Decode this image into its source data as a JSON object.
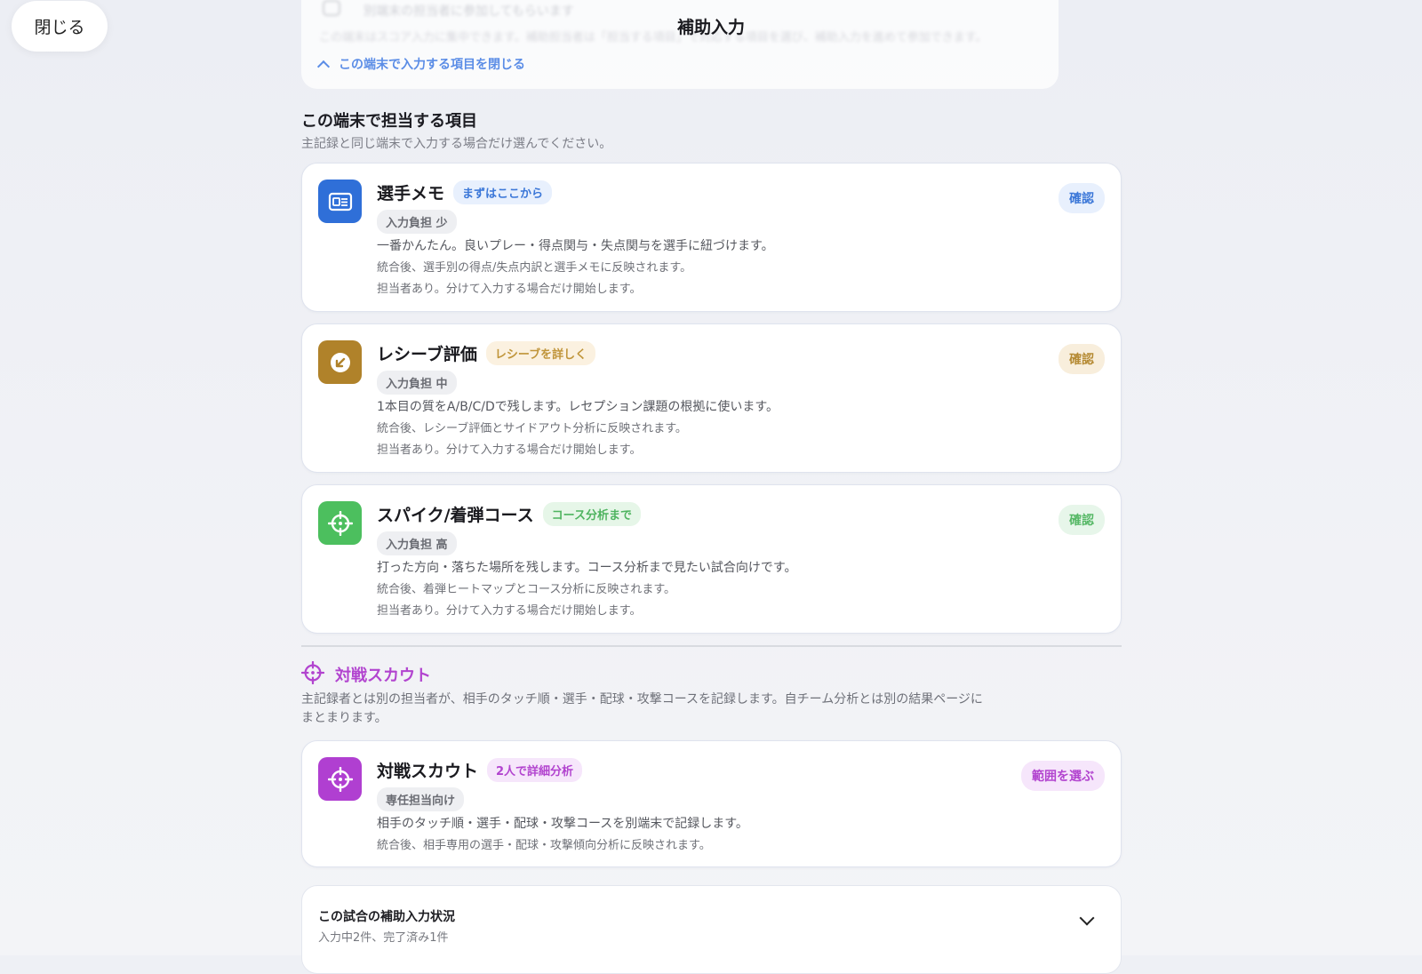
{
  "header": {
    "close_label": "閉じる",
    "title": "補助入力"
  },
  "top_panel": {
    "ghost_line1": "別端末の担当者に参加してもらいます",
    "ghost_line2": "この端末はスコア入力に集中できます。補助担当者は「担当する項目」で対応する項目を選び、補助入力を進めて参加できます。",
    "collapse_label": "この端末で入力する項目を閉じる"
  },
  "section": {
    "title": "この端末で担当する項目",
    "subtitle": "主記録と同じ端末で入力する場合だけ選んでください。"
  },
  "cards": [
    {
      "title": "選手メモ",
      "tag": "まずはここから",
      "load": "入力負担 少",
      "desc": "一番かんたん。良いプレー・得点関与・失点関与を選手に紐づけます。",
      "result": "統合後、選手別の得点/失点内訳と選手メモに反映されます。",
      "note": "担当者あり。分けて入力する場合だけ開始します。",
      "action": "確認",
      "icon": "id-card-icon",
      "accent": "#2f6fd8"
    },
    {
      "title": "レシーブ評価",
      "tag": "レシーブを詳しく",
      "load": "入力負担 中",
      "desc": "1本目の質をA/B/C/Dで残します。レセプション課題の根拠に使います。",
      "result": "統合後、レシーブ評価とサイドアウト分析に反映されます。",
      "note": "担当者あり。分けて入力する場合だけ開始します。",
      "action": "確認",
      "icon": "arrow-down-left-icon",
      "accent": "#b0822a"
    },
    {
      "title": "スパイク/着弾コース",
      "tag": "コース分析まで",
      "load": "入力負担 高",
      "desc": "打った方向・落ちた場所を残します。コース分析まで見たい試合向けです。",
      "result": "統合後、着弾ヒートマップとコース分析に反映されます。",
      "note": "担当者あり。分けて入力する場合だけ開始します。",
      "action": "確認",
      "icon": "crosshair-icon",
      "accent": "#4cbf5e"
    }
  ],
  "scout": {
    "heading": "対戦スカウト",
    "description": "主記録者とは別の担当者が、相手のタッチ順・選手・配球・攻撃コースを記録します。自チーム分析とは別の結果ページにまとまります。",
    "card": {
      "title": "対戦スカウト",
      "tag": "2人で詳細分析",
      "load": "専任担当向け",
      "desc": "相手のタッチ順・選手・配球・攻撃コースを別端末で記録します。",
      "result": "統合後、相手専用の選手・配球・攻撃傾向分析に反映されます。",
      "action": "範囲を選ぶ",
      "icon": "crosshair-icon",
      "accent": "#b03fd1"
    }
  },
  "status": {
    "title": "この試合の補助入力状況",
    "summary": "入力中2件、完了済み1件"
  }
}
